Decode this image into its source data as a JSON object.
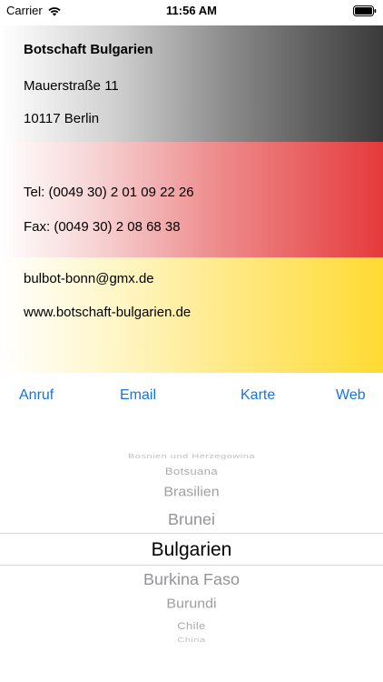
{
  "status_bar": {
    "carrier": "Carrier",
    "time": "11:56 AM",
    "wifi_icon": "wifi-icon",
    "battery_icon": "battery-icon"
  },
  "embassy": {
    "name": "Botschaft Bulgarien",
    "street": "Mauerstraße 11",
    "city": "10117 Berlin",
    "tel": "Tel: (0049 30) 2 01 09 22 26",
    "fax": "Fax: (0049 30) 2 08 68 38",
    "email": "bulbot-bonn@gmx.de",
    "web": "www.botschaft-bulgarien.de"
  },
  "actions": {
    "call": "Anruf",
    "email": "Email",
    "map": "Karte",
    "web": "Web"
  },
  "picker": {
    "items": [
      "Bosnien und Herzegowina",
      "Botsuana",
      "Brasilien",
      "Brunei",
      "Bulgarien",
      "Burkina Faso",
      "Burundi",
      "Chile",
      "China"
    ],
    "selected": "Bulgarien"
  },
  "colors": {
    "black_band": "#3a3a3a",
    "red_band": "#e53a3b",
    "gold_band": "#ffdb33",
    "link": "#1a73d9",
    "picker_inactive": "#8e8e93"
  }
}
